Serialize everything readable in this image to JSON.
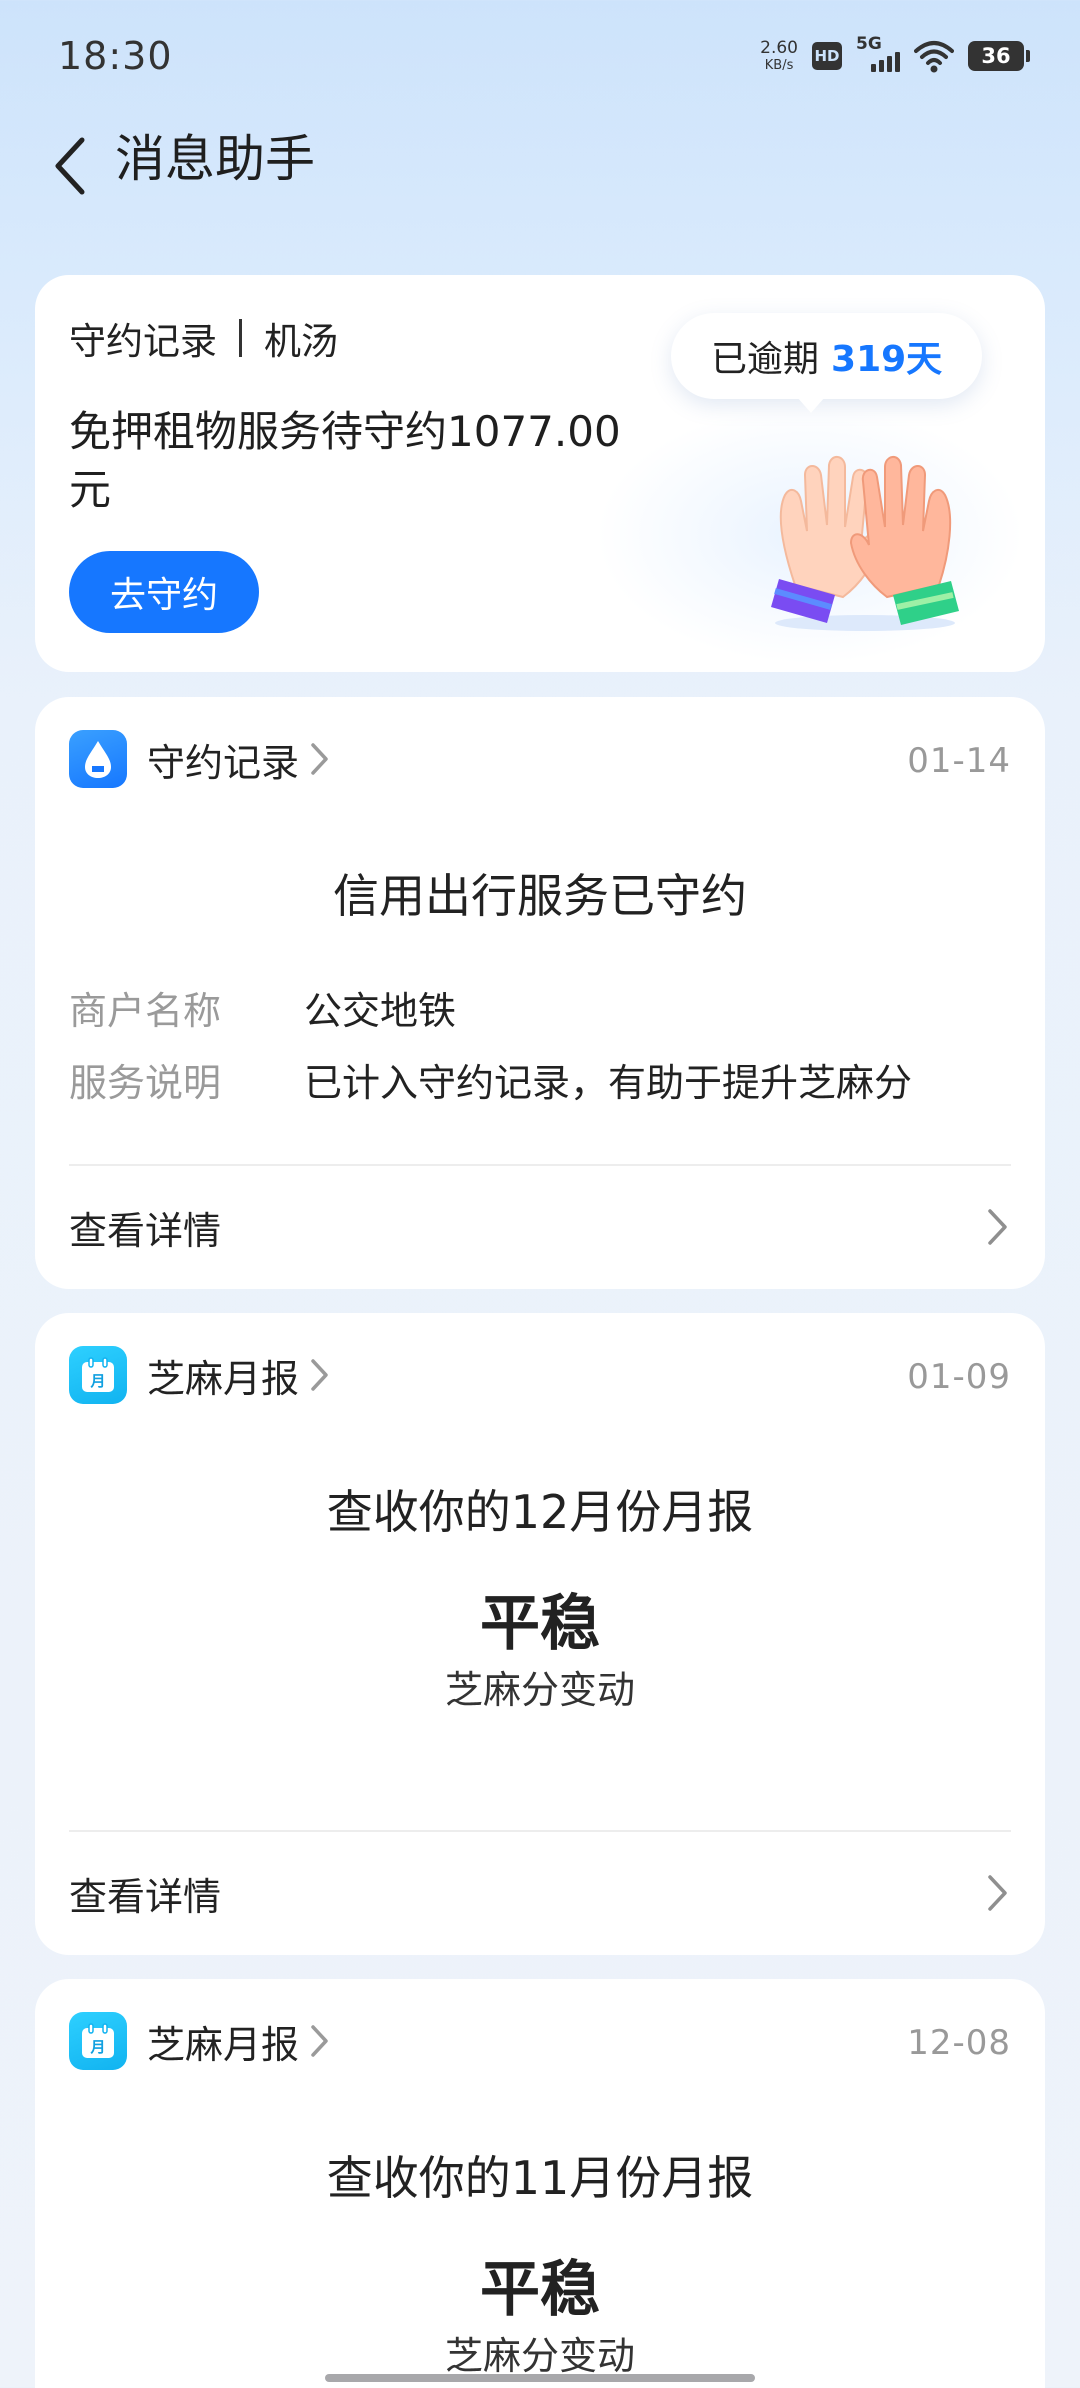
{
  "status_bar": {
    "time": "18:30",
    "net_speed_value": "2.60",
    "net_speed_unit": "KB/s",
    "hd_label": "HD",
    "network_type": "5G",
    "battery_level": "36"
  },
  "header": {
    "title": "消息助手"
  },
  "summary_card": {
    "tag_left": "守约记录",
    "tag_right": "机汤",
    "text": "免押租物服务待守约1077.00元",
    "button_label": "去守约",
    "overdue_prefix": "已逾期",
    "overdue_days": "319天"
  },
  "messages": [
    {
      "source": "守约记录",
      "icon": "zhima-drop-icon",
      "date": "01-14",
      "title": "信用出行服务已守约",
      "fields": [
        {
          "key": "商户名称",
          "value": "公交地铁"
        },
        {
          "key": "服务说明",
          "value": "已计入守约记录，有助于提升芝麻分"
        }
      ],
      "detail_label": "查看详情"
    },
    {
      "source": "芝麻月报",
      "icon": "calendar-month-icon",
      "icon_text": "月",
      "date": "01-09",
      "title": "查收你的12月份月报",
      "status": "平稳",
      "status_sub": "芝麻分变动",
      "detail_label": "查看详情"
    },
    {
      "source": "芝麻月报",
      "icon": "calendar-month-icon",
      "icon_text": "月",
      "date": "12-08",
      "title": "查收你的11月份月报",
      "status": "平稳",
      "status_sub": "芝麻分变动"
    }
  ],
  "colors": {
    "accent": "#1677ff",
    "muted": "#9a9a9a",
    "background_top": "#cde3fb"
  }
}
